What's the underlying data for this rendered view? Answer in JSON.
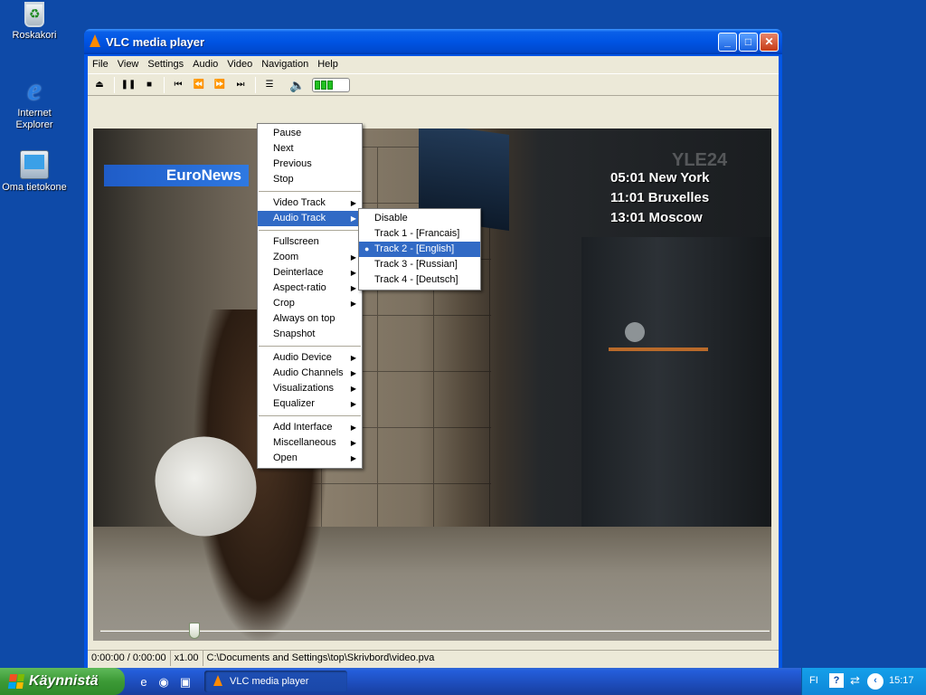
{
  "desktop": {
    "icons": [
      {
        "label": "Roskakori"
      },
      {
        "label": "Internet Explorer"
      },
      {
        "label": "Oma tietokone"
      }
    ]
  },
  "window": {
    "title": "VLC media player",
    "menubar": [
      "File",
      "View",
      "Settings",
      "Audio",
      "Video",
      "Navigation",
      "Help"
    ],
    "volume_level": 0.6
  },
  "video": {
    "channel_logo": "EuroNews",
    "watermark": "YLE24",
    "clocks": "05:01 New York\n11:01 Bruxelles\n13:01 Moscow"
  },
  "status": {
    "time": "0:00:00 / 0:00:00",
    "speed": "x1.00",
    "file": "C:\\Documents and Settings\\top\\Skrivbord\\video.pva",
    "seek_position": 0.14
  },
  "context_menu": {
    "group1": [
      "Pause",
      "Next",
      "Previous",
      "Stop"
    ],
    "group2": [
      "Video Track",
      "Audio Track"
    ],
    "group3": [
      "Fullscreen",
      "Zoom",
      "Deinterlace",
      "Aspect-ratio",
      "Crop",
      "Always on top",
      "Snapshot"
    ],
    "group4": [
      "Audio Device",
      "Audio Channels",
      "Visualizations",
      "Equalizer"
    ],
    "group5": [
      "Add Interface",
      "Miscellaneous",
      "Open"
    ],
    "selected": "Audio Track"
  },
  "submenu": {
    "items": [
      "Disable",
      "Track 1 - [Francais]",
      "Track 2 - [English]",
      "Track 3 - [Russian]",
      "Track 4 - [Deutsch]"
    ],
    "checked": "Track 2 - [English]"
  },
  "taskbar": {
    "start_label": "Käynnistä",
    "task_label": "VLC media player",
    "language": "FI",
    "clock": "15:17"
  },
  "colors": {
    "desktop": "#0e4aa8",
    "menu_highlight": "#316ac5",
    "start_green": "#3c9a36"
  }
}
